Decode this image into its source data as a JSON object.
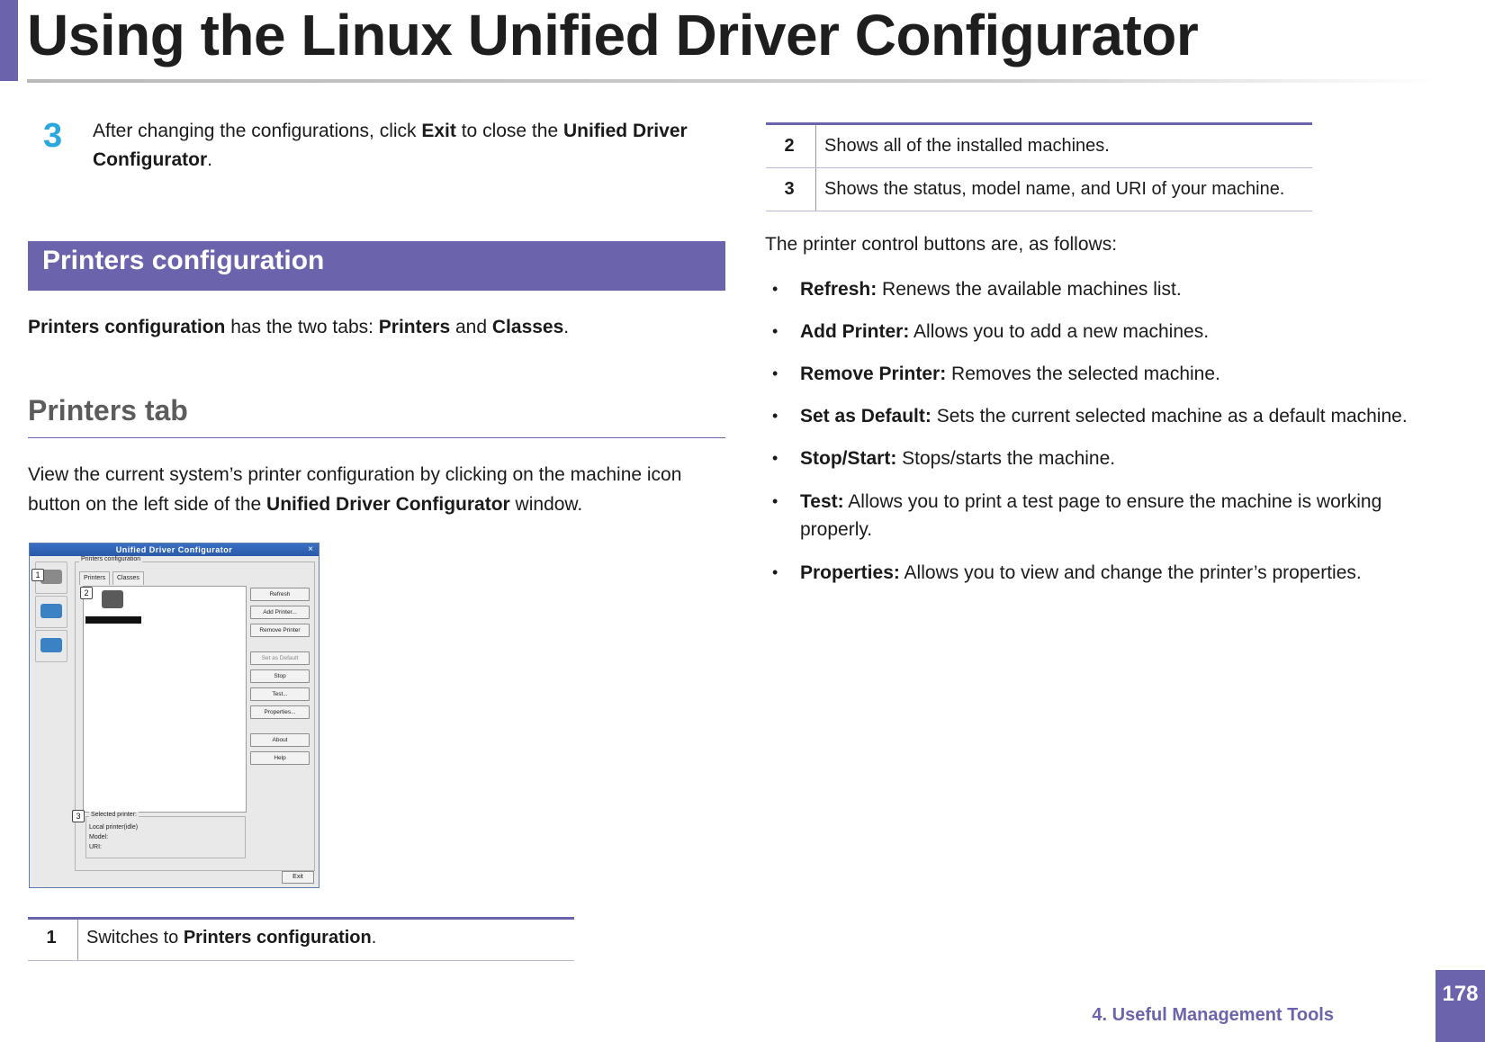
{
  "header": {
    "title": "Using the Linux Unified Driver Configurator"
  },
  "footer": {
    "chapter": "4.  Useful Management Tools",
    "page_number": "178"
  },
  "step": {
    "number": "3",
    "text_1": "After changing the configurations, click ",
    "bold_1": "Exit",
    "text_2": " to close the ",
    "bold_2": "Unified Driver Configurator",
    "text_3": "."
  },
  "section": {
    "title": "Printers configuration"
  },
  "intro": {
    "bold_1": "Printers configuration",
    "text_1": " has the two tabs: ",
    "bold_2": "Printers",
    "text_2": " and ",
    "bold_3": "Classes",
    "text_3": "."
  },
  "subsection": {
    "title": "Printers tab"
  },
  "view_para": {
    "text_1": "View the current system’s printer configuration by clicking on the machine icon button on the left side of the ",
    "bold_1": "Unified Driver Configurator",
    "text_2": " window."
  },
  "screenshot": {
    "window_title": "Unified Driver Configurator",
    "close_glyph": "×",
    "group_label": "Printers configuration",
    "tabs": [
      "Printers",
      "Classes"
    ],
    "buttons": [
      "Refresh",
      "Add Printer...",
      "Remove Printer",
      "Set as Default",
      "Stop",
      "Test...",
      "Properties...",
      "About",
      "Help"
    ],
    "selected_label": "Selected printer:",
    "selected_lines": [
      "Local printer(idle)",
      "Model:",
      "URI:"
    ],
    "exit_label": "Exit",
    "callouts": [
      "1",
      "2",
      "3"
    ],
    "side_icon_colors": [
      "#8a8a8a",
      "#3b82c4",
      "#3b82c4"
    ]
  },
  "table_left": {
    "rows": [
      {
        "num": "1",
        "text": "Switches to ",
        "bold": "Printers configuration",
        "tail": "."
      }
    ]
  },
  "table_right": {
    "rows": [
      {
        "num": "2",
        "text": "Shows all of the installed machines."
      },
      {
        "num": "3",
        "text": "Shows the status, model name, and URI of your machine."
      }
    ]
  },
  "controls": {
    "intro": "The printer control buttons are, as follows:",
    "bullet_glyph": "•",
    "items": [
      {
        "label": "Refresh:",
        "text": " Renews the available machines list."
      },
      {
        "label": "Add Printer:",
        "text": " Allows you to add a new machines."
      },
      {
        "label": "Remove Printer:",
        "text": " Removes the selected machine."
      },
      {
        "label": "Set as Default:",
        "text": " Sets the current selected machine as a default machine."
      },
      {
        "label": "Stop/Start:",
        "text": " Stops/starts the machine."
      },
      {
        "label": "Test:",
        "text": " Allows you to print a test page to ensure the machine is working properly."
      },
      {
        "label": "Properties:",
        "text": " Allows you to view and change the printer’s properties."
      }
    ]
  },
  "colors": {
    "accent": "#6b64ad",
    "step_number": "#29a8e0"
  }
}
